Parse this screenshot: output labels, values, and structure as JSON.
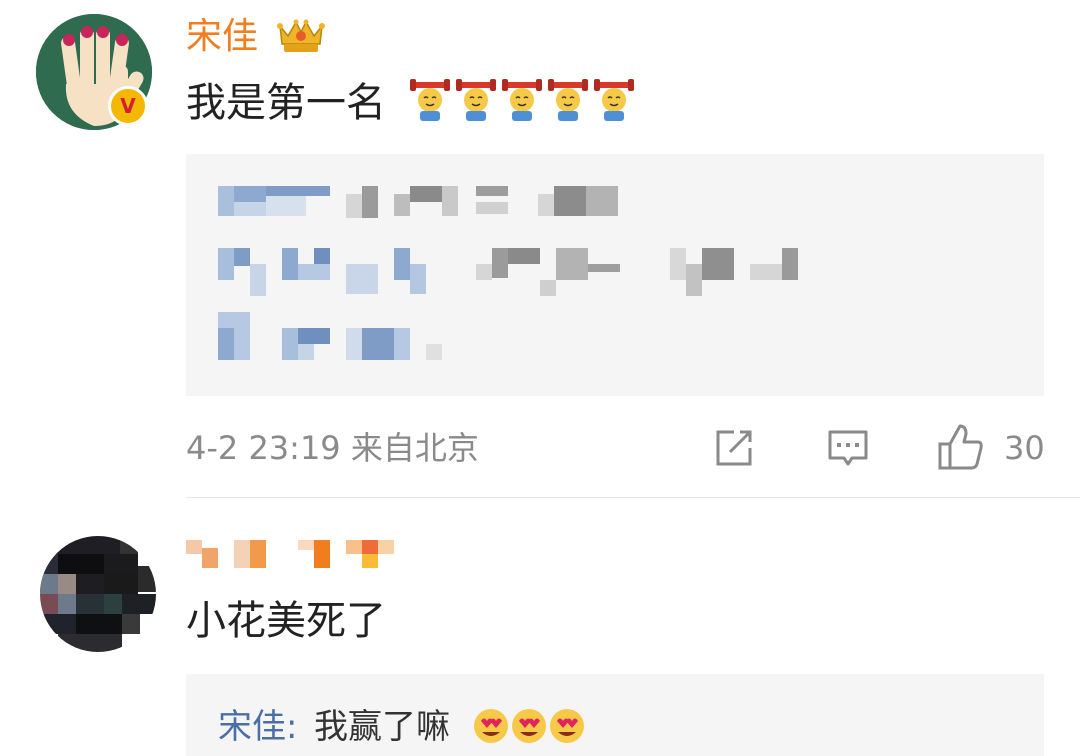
{
  "comment1": {
    "username": "宋佳",
    "text": "我是第一名",
    "time": "4-2 23:19",
    "location": "来自北京",
    "likes": "30"
  },
  "comment2": {
    "text": "小花美死了",
    "reply": {
      "name": "宋佳:",
      "text": "我赢了嘛"
    }
  },
  "icons": {
    "badge": "vip-crown-icon",
    "verified": "verified-v-icon",
    "emoji_strong": "strong-emoji",
    "emoji_heart_eyes": "heart-eyes-emoji",
    "share": "share-icon",
    "comment": "comment-icon",
    "like": "thumbs-up-icon"
  },
  "colors": {
    "username": "#f07e1e",
    "reply_name": "#4a6fa5",
    "meta": "#8a8a8a",
    "quote_bg": "#f5f5f5"
  }
}
